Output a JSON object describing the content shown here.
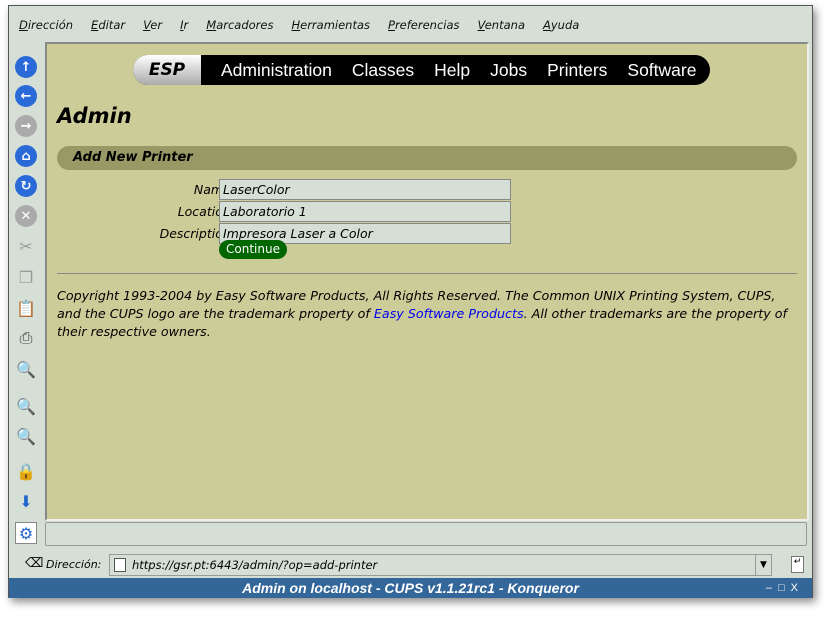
{
  "menu": [
    "Dirección",
    "Editar",
    "Ver",
    "Ir",
    "Marcadores",
    "Herramientas",
    "Preferencias",
    "Ventana",
    "Ayuda"
  ],
  "nav": {
    "logo": "ESP",
    "items": [
      "Administration",
      "Classes",
      "Help",
      "Jobs",
      "Printers",
      "Software"
    ]
  },
  "page_title": "Admin",
  "section_title": "Add New Printer",
  "form": {
    "name_label": "Name:",
    "name_value": "LaserColor",
    "location_label": "Location:",
    "location_value": "Laboratorio 1",
    "description_label": "Description:",
    "description_value": "Impresora Laser a Color",
    "continue_label": "Continue"
  },
  "footer": {
    "text1": "Copyright 1993-2004 by Easy Software Products, All Rights Reserved. The Common UNIX Printing System, CUPS, and the CUPS logo are the trademark property of ",
    "link": "Easy Software Products",
    "text2": ". All other trademarks are the property of their respective owners."
  },
  "address": {
    "label": "Dirección:",
    "url": "https://gsr.pt:6443/admin/?op=add-printer"
  },
  "window_title": "Admin on localhost - CUPS v1.1.21rc1 - Konqueror",
  "window_controls": [
    "–",
    "□",
    "X"
  ]
}
